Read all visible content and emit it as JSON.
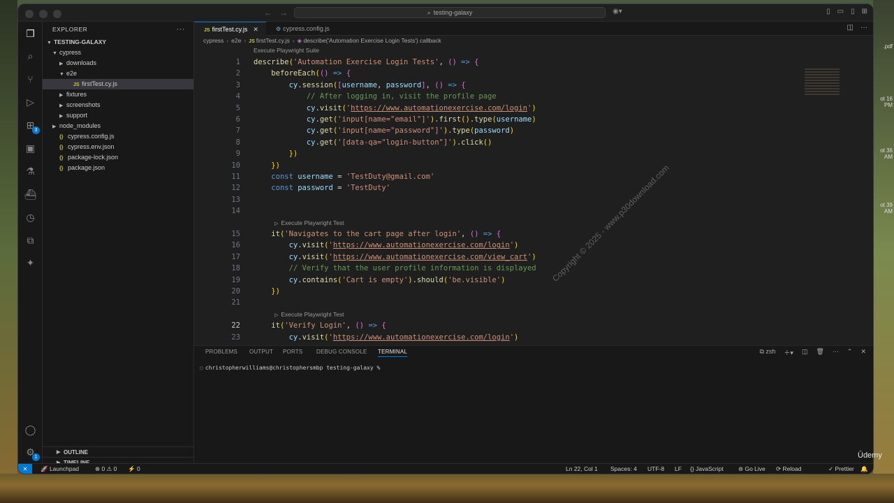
{
  "window": {
    "search_text": "testing-galaxy"
  },
  "sidebar": {
    "title": "EXPLORER",
    "root": "TESTING-GALAXY",
    "tree": [
      {
        "label": "cypress",
        "type": "folder-open",
        "indent": 0
      },
      {
        "label": "downloads",
        "type": "folder",
        "indent": 1
      },
      {
        "label": "e2e",
        "type": "folder-open",
        "indent": 1
      },
      {
        "label": "firstTest.cy.js",
        "type": "js",
        "indent": 2,
        "selected": true
      },
      {
        "label": "fixtures",
        "type": "folder",
        "indent": 1
      },
      {
        "label": "screenshots",
        "type": "folder",
        "indent": 1
      },
      {
        "label": "support",
        "type": "folder",
        "indent": 1
      },
      {
        "label": "node_modules",
        "type": "folder",
        "indent": 0
      },
      {
        "label": "cypress.config.js",
        "type": "json",
        "indent": 0
      },
      {
        "label": "cypress.env.json",
        "type": "json",
        "indent": 0
      },
      {
        "label": "package-lock.json",
        "type": "json",
        "indent": 0
      },
      {
        "label": "package.json",
        "type": "json",
        "indent": 0
      }
    ],
    "outline": "OUTLINE",
    "timeline": "TIMELINE"
  },
  "tabs": [
    {
      "label": "firstTest.cy.js",
      "active": true
    },
    {
      "label": "cypress.config.js",
      "active": false
    }
  ],
  "breadcrumb": [
    "cypress",
    "e2e",
    "firstTest.cy.js",
    "describe('Automation Exercise Login Tests') callback"
  ],
  "codelens": {
    "suite": "Execute Playwright Suite",
    "test": "Execute Playwright Test"
  },
  "code_lines": [
    {
      "n": "1",
      "text": "describe('Automation Exercise Login Tests', () => {"
    },
    {
      "n": "2",
      "text": "    beforeEach(() => {"
    },
    {
      "n": "3",
      "text": "        cy.session([username, password], () => {"
    },
    {
      "n": "4",
      "text": "            // After logging in, visit the profile page"
    },
    {
      "n": "5",
      "text": "            cy.visit('https://www.automationexercise.com/login')"
    },
    {
      "n": "6",
      "text": "            cy.get('input[name=\"email\"]').first().type(username)"
    },
    {
      "n": "7",
      "text": "            cy.get('input[name=\"password\"]').type(password)"
    },
    {
      "n": "8",
      "text": "            cy.get('[data-qa=\"login-button\"]').click()"
    },
    {
      "n": "9",
      "text": "        })"
    },
    {
      "n": "10",
      "text": "    })"
    },
    {
      "n": "11",
      "text": "    const username = 'TestDuty@gmail.com'"
    },
    {
      "n": "12",
      "text": "    const password = 'TestDuty'"
    },
    {
      "n": "13",
      "text": ""
    },
    {
      "n": "14",
      "text": ""
    },
    {
      "n": "15",
      "text": "    it('Navigates to the cart page after login', () => {"
    },
    {
      "n": "16",
      "text": "        cy.visit('https://www.automationexercise.com/login')"
    },
    {
      "n": "17",
      "text": "        cy.visit('https://www.automationexercise.com/view_cart')"
    },
    {
      "n": "18",
      "text": "        // Verify that the user profile information is displayed"
    },
    {
      "n": "19",
      "text": "        cy.contains('Cart is empty').should('be.visible')"
    },
    {
      "n": "20",
      "text": "    })"
    },
    {
      "n": "21",
      "text": ""
    },
    {
      "n": "22",
      "text": "    it('Verify Login', () => {"
    },
    {
      "n": "23",
      "text": "        cy.visit('https://www.automationexercise.com/login')"
    }
  ],
  "watermark": "Copyright © 2025 - www.p30download.com",
  "panel": {
    "tabs": [
      "PROBLEMS",
      "OUTPUT",
      "PORTS",
      "DEBUG CONSOLE",
      "TERMINAL"
    ],
    "active_tab": "TERMINAL",
    "shell": "zsh",
    "prompt": "christopherwilliams@christophersmbp testing-galaxy %"
  },
  "statusbar": {
    "launchpad": "Launchpad",
    "errors": "0",
    "warnings": "0",
    "ports": "0",
    "position": "Ln 22, Col 1",
    "spaces": "Spaces: 4",
    "encoding": "UTF-8",
    "eol": "LF",
    "language": "JavaScript",
    "golive": "Go Live",
    "reload": "Reload",
    "prettier": "Prettier"
  },
  "desktop_notes": [
    ".pdf",
    "ot 16 PM",
    "ot 36 AM",
    "ot 39 AM"
  ],
  "udemy_logo": "Ūdemy",
  "colors": {
    "accent": "#0078d4",
    "keyword": "#569cd6",
    "function": "#dcdcaa",
    "string": "#ce9178",
    "variable": "#9cdcfe",
    "comment": "#6a9955"
  }
}
